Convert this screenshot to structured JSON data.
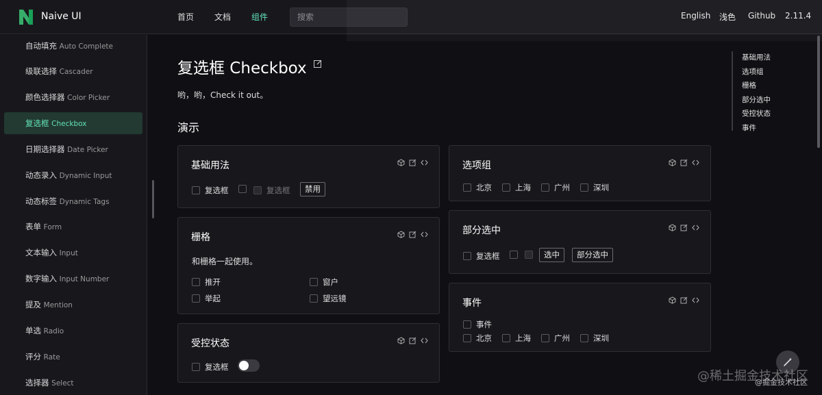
{
  "header": {
    "brand": "Naive UI",
    "nav": [
      {
        "label": "首页",
        "active": false
      },
      {
        "label": "文档",
        "active": false
      },
      {
        "label": "组件",
        "active": true
      }
    ],
    "search_placeholder": "搜索",
    "right": [
      "English",
      "浅色",
      "Github",
      "2.11.4"
    ],
    "accent": "#63e2b7"
  },
  "sidebar": {
    "items": [
      {
        "zh": "自动填充",
        "en": "Auto Complete",
        "active": false
      },
      {
        "zh": "级联选择",
        "en": "Cascader",
        "active": false
      },
      {
        "zh": "颜色选择器",
        "en": "Color Picker",
        "active": false
      },
      {
        "zh": "复选框",
        "en": "Checkbox",
        "active": true
      },
      {
        "zh": "日期选择器",
        "en": "Date Picker",
        "active": false
      },
      {
        "zh": "动态录入",
        "en": "Dynamic Input",
        "active": false
      },
      {
        "zh": "动态标签",
        "en": "Dynamic Tags",
        "active": false
      },
      {
        "zh": "表单",
        "en": "Form",
        "active": false
      },
      {
        "zh": "文本输入",
        "en": "Input",
        "active": false
      },
      {
        "zh": "数字输入",
        "en": "Input Number",
        "active": false
      },
      {
        "zh": "提及",
        "en": "Mention",
        "active": false
      },
      {
        "zh": "单选",
        "en": "Radio",
        "active": false
      },
      {
        "zh": "评分",
        "en": "Rate",
        "active": false
      },
      {
        "zh": "选择器",
        "en": "Select",
        "active": false
      }
    ]
  },
  "main": {
    "title": "复选框 Checkbox",
    "description": "哟，哟，Check it out。",
    "section": "演示",
    "cards": {
      "basic": {
        "title": "基础用法",
        "checkbox1": "复选框",
        "checkbox3": "复选框",
        "button": "禁用"
      },
      "grid": {
        "title": "栅格",
        "text": "和栅格一起使用。",
        "items": [
          "推开",
          "窗户",
          "举起",
          "望远镜"
        ]
      },
      "controlled": {
        "title": "受控状态",
        "checkbox": "复选框"
      },
      "group": {
        "title": "选项组",
        "items": [
          "北京",
          "上海",
          "广州",
          "深圳"
        ]
      },
      "partial": {
        "title": "部分选中",
        "checkbox": "复选框",
        "btn1": "选中",
        "btn2": "部分选中"
      },
      "events": {
        "title": "事件",
        "first": "事件",
        "items": [
          "北京",
          "上海",
          "广州",
          "深圳"
        ]
      }
    }
  },
  "anchor": [
    "基础用法",
    "选项组",
    "栅格",
    "部分选中",
    "受控状态",
    "事件"
  ],
  "watermark": "@稀土掘金技术社区",
  "watermark2": "@掘金技术社区"
}
